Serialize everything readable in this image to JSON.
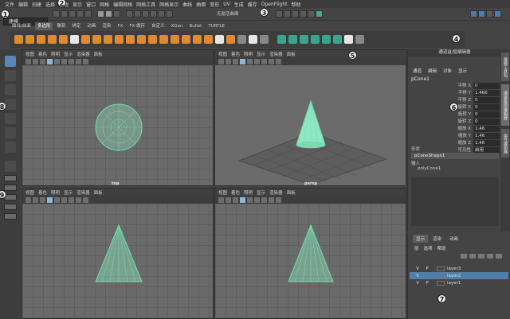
{
  "menubar": [
    "文件",
    "编辑",
    "创建",
    "选择",
    "修改",
    "显示",
    "窗口",
    "网格",
    "编辑网格",
    "网格工具",
    "网格显示",
    "曲线",
    "曲面",
    "变形",
    "UV",
    "生成",
    "缓存",
    "OpenFlight",
    "帮助"
  ],
  "toolline": {
    "mode": "建模",
    "live_surface": "无激活曲面"
  },
  "shelf_tabs": [
    "曲线/曲面",
    "多边形",
    "雕刻",
    "绑定",
    "动画",
    "渲染",
    "FX",
    "FX 缓存",
    "自定义",
    "XGen",
    "Bullet",
    "TURTLE"
  ],
  "shelf_active": "多边形",
  "viewports": [
    {
      "camera": "top",
      "menu": [
        "视图",
        "着色",
        "照明",
        "显示",
        "渲染器",
        "面板"
      ]
    },
    {
      "camera": "persp",
      "menu": [
        "视图",
        "着色",
        "照明",
        "显示",
        "渲染器",
        "面板"
      ]
    },
    {
      "camera": "",
      "menu": [
        "视图",
        "着色",
        "照明",
        "显示",
        "渲染器",
        "面板"
      ]
    },
    {
      "camera": "",
      "menu": [
        "视图",
        "着色",
        "照明",
        "显示",
        "渲染器",
        "面板"
      ]
    }
  ],
  "channel_box": {
    "title": "通道盒/层编辑器",
    "menu": [
      "通道",
      "编辑",
      "对象",
      "显示"
    ],
    "object": "pCone1",
    "attributes": [
      {
        "name": "平移 X",
        "value": "0"
      },
      {
        "name": "平移 Y",
        "value": "1.466"
      },
      {
        "name": "平移 Z",
        "value": "0"
      },
      {
        "name": "旋转 X",
        "value": "0"
      },
      {
        "name": "旋转 Y",
        "value": "0"
      },
      {
        "name": "旋转 Z",
        "value": "0"
      },
      {
        "name": "缩放 X",
        "value": "1.46"
      },
      {
        "name": "缩放 Y",
        "value": "1.46"
      },
      {
        "name": "缩放 Z",
        "value": "1.46"
      },
      {
        "name": "可见性",
        "value": "启用"
      }
    ],
    "shape_label": "形状",
    "shape": "pConeShape1",
    "input_label": "输入",
    "input": "polyCone1"
  },
  "side_tabs": [
    "建模工具包",
    "通道盒/层编辑器",
    "属性编辑器"
  ],
  "layer_editor": {
    "tabs": [
      "显示",
      "渲染",
      "动画"
    ],
    "menu": [
      "层",
      "选项",
      "帮助"
    ],
    "layers": [
      {
        "v": "V",
        "p": "P",
        "name": "layer3",
        "selected": false
      },
      {
        "v": "V",
        "p": "",
        "name": "layer2",
        "selected": true
      },
      {
        "v": "V",
        "p": "P",
        "name": "layer1",
        "selected": false
      }
    ]
  },
  "badges": [
    "1",
    "2",
    "3",
    "4",
    "5",
    "6",
    "7",
    "8",
    "9"
  ],
  "colors": {
    "accent": "#4aa39a",
    "selection": "#4f7fa8",
    "shelf_orange": "#e08a30",
    "mesh": "#6fe0b0"
  }
}
